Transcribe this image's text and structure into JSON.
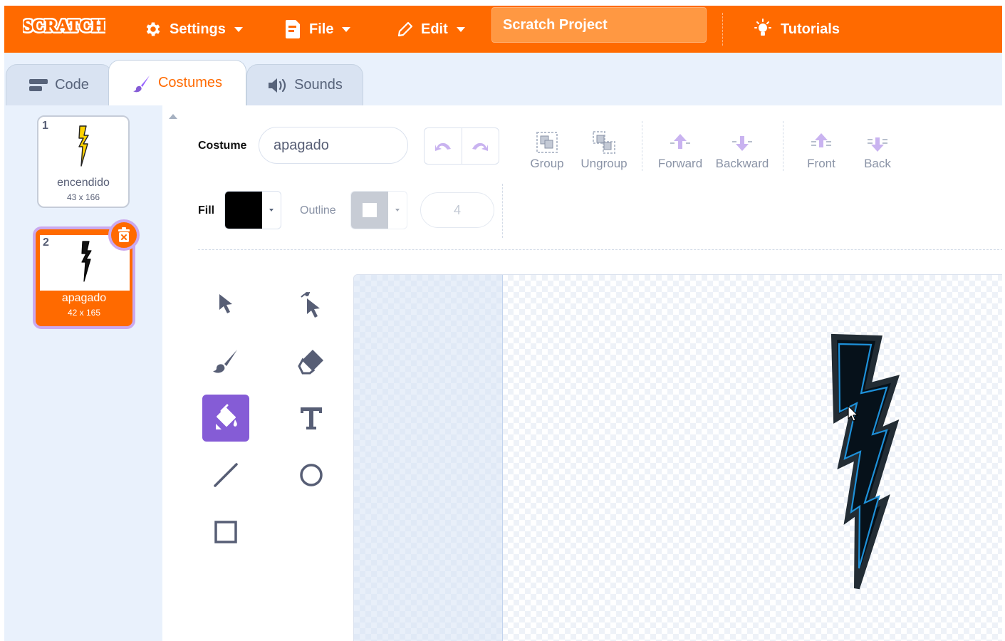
{
  "menu": {
    "logo_text": "SCRATCH",
    "settings_label": "Settings",
    "file_label": "File",
    "edit_label": "Edit",
    "project_title": "Scratch Project",
    "tutorials_label": "Tutorials"
  },
  "tabs": [
    {
      "label": "Code",
      "icon": "code-blocks-icon"
    },
    {
      "label": "Costumes",
      "icon": "paintbrush-icon"
    },
    {
      "label": "Sounds",
      "icon": "speaker-icon"
    }
  ],
  "costumes": [
    {
      "index": "1",
      "name": "encendido",
      "size": "43 x 166",
      "color": "#ffd200",
      "selected": false
    },
    {
      "index": "2",
      "name": "apagado",
      "size": "42 x 165",
      "color": "#000000",
      "selected": true
    }
  ],
  "editor": {
    "costume_label": "Costume",
    "costume_name": "apagado",
    "group_label": "Group",
    "ungroup_label": "Ungroup",
    "forward_label": "Forward",
    "backward_label": "Backward",
    "front_label": "Front",
    "back_label": "Back",
    "fill_label": "Fill",
    "fill_color": "#000000",
    "outline_label": "Outline",
    "outline_width": "4"
  },
  "tools": [
    "select-arrow-icon",
    "reshape-icon",
    "brush-icon",
    "eraser-icon",
    "fill-bucket-icon",
    "text-tool-icon",
    "line-tool-icon",
    "circle-tool-icon",
    "rectangle-tool-icon"
  ],
  "active_tool": "fill-bucket-icon",
  "colors": {
    "brand": "#ff6a00",
    "accent": "#855cd6",
    "outline_stroke": "#1e90d8"
  }
}
